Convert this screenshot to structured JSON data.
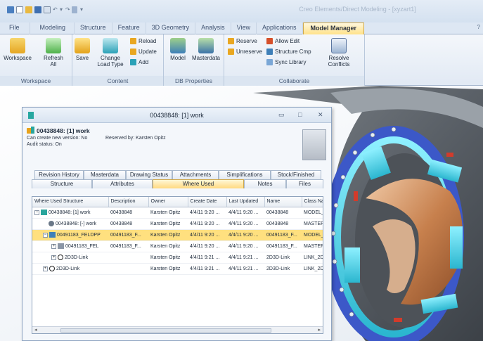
{
  "app": {
    "title": "Creo Elements/Direct Modeling - [xyzart1]",
    "accent": "#ffd980"
  },
  "ribbon_tabs": [
    {
      "label": "File"
    },
    {
      "label": "Modeling"
    },
    {
      "label": "Structure"
    },
    {
      "label": "Feature"
    },
    {
      "label": "3D Geometry"
    },
    {
      "label": "Analysis"
    },
    {
      "label": "View"
    },
    {
      "label": "Applications"
    },
    {
      "label": "Model Manager"
    }
  ],
  "ribbon": {
    "workspace": {
      "label": "Workspace",
      "btn_workspace": "Workspace",
      "btn_refresh_1": "Refresh",
      "btn_refresh_2": "All"
    },
    "content": {
      "label": "Content",
      "btn_save": "Save",
      "btn_change_1": "Change",
      "btn_change_2": "Load Type",
      "btn_reload": "Reload",
      "btn_update": "Update",
      "btn_add": "Add"
    },
    "db_properties": {
      "label": "DB Properties",
      "btn_model": "Model",
      "btn_masterdata": "Masterdata"
    },
    "collaborate": {
      "label": "Collaborate",
      "btn_reserve": "Reserve",
      "btn_unreserve": "Unreserve",
      "btn_allow_edit": "Allow Edit",
      "btn_structure_cmp": "Structure Cmp",
      "btn_sync_library": "Sync Library",
      "btn_resolve_1": "Resolve",
      "btn_resolve_2": "Conflicts"
    }
  },
  "dialog": {
    "title": "00438848: [1] work",
    "object_name": "00438848: [1] work",
    "can_create": "Can create new version: No",
    "reserved_by": "Reserved by: Karsten Opitz",
    "audit_status": "Audit status: On",
    "tabs_row1": [
      "Revision History",
      "Masterdata",
      "Drawing Status",
      "Attachments",
      "Simplifications",
      "Stock/Finished"
    ],
    "tabs_row2": [
      "Structure",
      "Attributes",
      "Where Used",
      "Notes",
      "Files"
    ],
    "active_tab": "Where Used",
    "columns": [
      "Where Used Structure",
      "Description",
      "Owner",
      "Create Date",
      "Last Updated",
      "Name",
      "Class Na"
    ],
    "rows": [
      {
        "structure": "00438848: [1] work",
        "description": "00438848",
        "owner": "Karsten Opitz",
        "create": "4/4/11 9:20 ...",
        "updated": "4/4/11 9:20 ...",
        "name": "00438848",
        "class": "MODEL_"
      },
      {
        "structure": "00438848: [-] work",
        "description": "00438848",
        "owner": "Karsten Opitz",
        "create": "4/4/11 9:20 ...",
        "updated": "4/4/11 9:20 ...",
        "name": "00438848",
        "class": "MASTER"
      },
      {
        "structure": "00491183_FELDPP",
        "description": "00491183_F...",
        "owner": "Karsten Opitz",
        "create": "4/4/11 9:20 ...",
        "updated": "4/4/11 9:20 ...",
        "name": "00491183_F...",
        "class": "MODEL_"
      },
      {
        "structure": "00491183_FEL",
        "description": "00491183_F...",
        "owner": "Karsten Opitz",
        "create": "4/4/11 9:20 ...",
        "updated": "4/4/11 9:20 ...",
        "name": "00491183_F...",
        "class": "MASTER"
      },
      {
        "structure": "2D3D-Link",
        "description": "",
        "owner": "Karsten Opitz",
        "create": "4/4/11 9:21 ...",
        "updated": "4/4/11 9:21 ...",
        "name": "2D3D-Link",
        "class": "LINK_2D"
      },
      {
        "structure": "2D3D-Link",
        "description": "",
        "owner": "Karsten Opitz",
        "create": "4/4/11 9:21 ...",
        "updated": "4/4/11 9:21 ...",
        "name": "2D3D-Link",
        "class": "LINK_2D"
      }
    ]
  }
}
